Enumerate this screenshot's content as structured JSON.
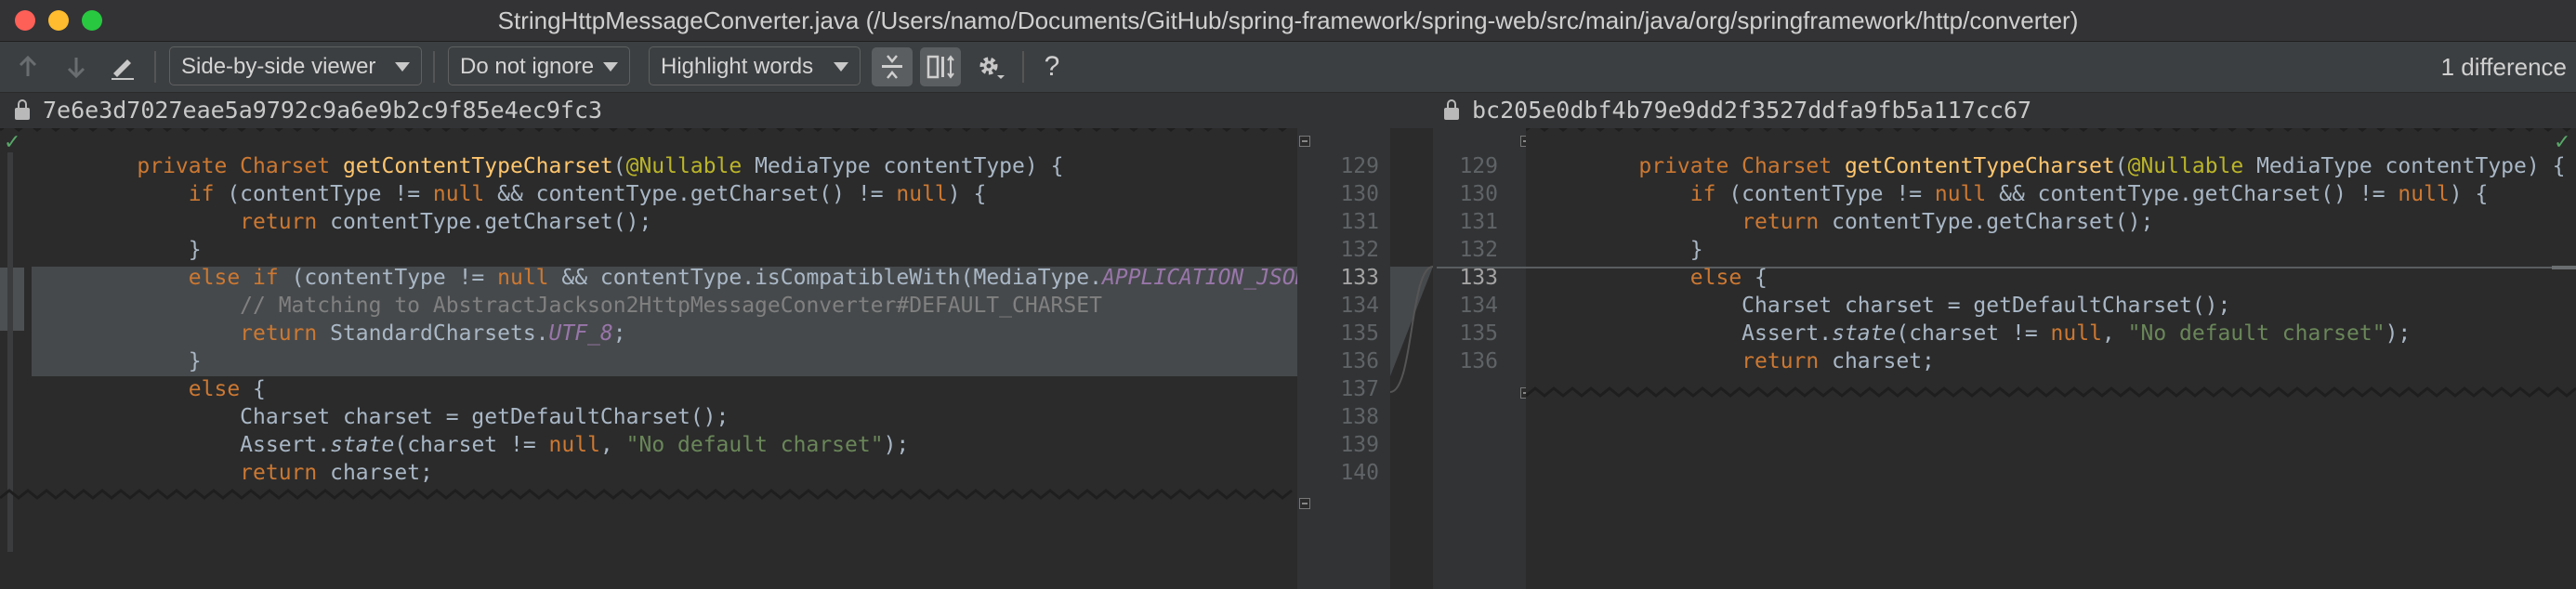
{
  "window": {
    "title": "StringHttpMessageConverter.java (/Users/namo/Documents/GitHub/spring-framework/spring-web/src/main/java/org/springframework/http/converter)"
  },
  "toolbar": {
    "viewer_mode": "Side-by-side viewer",
    "ignore_mode": "Do not ignore",
    "highlight_mode": "Highlight words",
    "help_label": "?",
    "difference_count": "1 difference",
    "icons": [
      "arrow-up-icon",
      "arrow-down-icon",
      "edit-icon",
      "collapse-unchanged-icon",
      "sync-scroll-icon",
      "gear-icon",
      "help-icon"
    ]
  },
  "left_pane": {
    "revision": "7e6e3d7027eae5a9792c9a6e9b2c9f85e4ec9fc3",
    "line_numbers": [
      "129",
      "130",
      "131",
      "132",
      "133",
      "134",
      "135",
      "136",
      "137",
      "138",
      "139",
      "140"
    ],
    "lines": [
      [
        "    ",
        "private Charset ",
        "getContentTypeCharset",
        "(",
        "@Nullable",
        " MediaType contentType) {"
      ],
      [
        "        ",
        "if",
        " (contentType != ",
        "null",
        " && contentType.getCharset() != ",
        "null",
        ") {"
      ],
      [
        "            ",
        "return",
        " contentType.getCharset();"
      ],
      [
        "        }"
      ],
      [
        "        ",
        "else if",
        " (contentType != ",
        "null",
        " && contentType.isCompatibleWith(MediaType.",
        "APPLICATION_JSON",
        ")"
      ],
      [
        "            ",
        "// Matching to AbstractJackson2HttpMessageConverter#DEFAULT_CHARSET"
      ],
      [
        "            ",
        "return",
        " StandardCharsets.",
        "UTF_8",
        ";"
      ],
      [
        "        }"
      ],
      [
        "        ",
        "else",
        " {"
      ],
      [
        "            Charset charset = getDefaultCharset();"
      ],
      [
        "            Assert.",
        "state",
        "(charset != ",
        "null",
        ", ",
        "\"No default charset\"",
        ");"
      ],
      [
        "            ",
        "return",
        " charset;"
      ]
    ]
  },
  "right_pane": {
    "revision": "bc205e0dbf4b79e9dd2f3527ddfa9fb5a117cc67",
    "line_numbers": [
      "129",
      "130",
      "131",
      "132",
      "133",
      "134",
      "135",
      "136"
    ],
    "lines": [
      [
        "    ",
        "private Charset ",
        "getContentTypeCharset",
        "(",
        "@Nullable",
        " MediaType contentType) {"
      ],
      [
        "        ",
        "if",
        " (contentType != ",
        "null",
        " && contentType.getCharset() != ",
        "null",
        ") {"
      ],
      [
        "            ",
        "return",
        " contentType.getCharset();"
      ],
      [
        "        }"
      ],
      [
        "        ",
        "else",
        " {"
      ],
      [
        "            Charset charset = getDefaultCharset();"
      ],
      [
        "            Assert.",
        "state",
        "(charset != ",
        "null",
        ", ",
        "\"No default charset\"",
        ");"
      ],
      [
        "            ",
        "return",
        " charset;"
      ]
    ]
  },
  "colors": {
    "keyword": "#cc7832",
    "method": "#ffc66d",
    "annotation": "#bbb529",
    "string": "#6a8759",
    "comment": "#808080",
    "constant": "#9876aa",
    "text": "#a9b7c6",
    "changed_block": "#46494b"
  }
}
